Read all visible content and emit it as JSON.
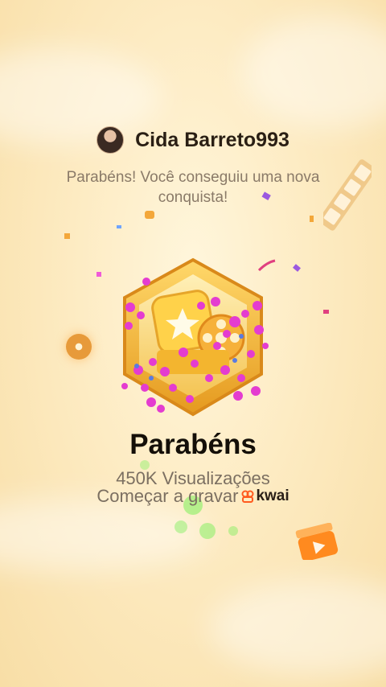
{
  "user": {
    "name": "Cida Barreto993"
  },
  "message": {
    "subtitle": "Parabéns! Você conseguiu uma nova conquista!"
  },
  "achievement": {
    "title": "Parabéns",
    "views": "450K Visualizações",
    "cta": "Começar a gravar",
    "brand": "kwai"
  },
  "colors": {
    "background": "#fdebc2",
    "badge_gold": "#f3b52f",
    "hearts": "#e43cd0",
    "brand_orange": "#ff5a1f"
  },
  "icons": [
    "avatar",
    "achievement-badge-icon",
    "film-reel-icon",
    "clapperboard-icon",
    "film-strip-icon",
    "kwai-logo-icon"
  ]
}
